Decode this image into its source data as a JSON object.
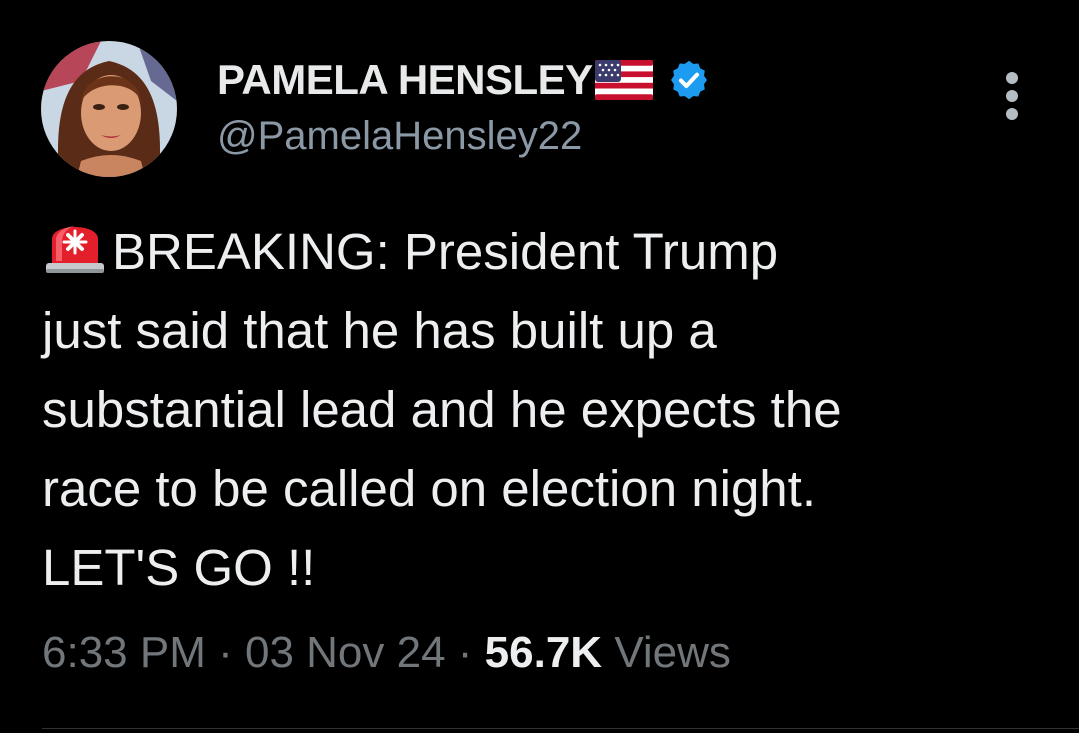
{
  "author": {
    "display_name": "PAMELA HENSLEY",
    "handle": "@PamelaHensley22",
    "flag_icon": "us-flag-icon",
    "verified_icon": "verified-badge-icon",
    "verified_color": "#1d9bf0"
  },
  "tweet": {
    "lines": [
      "BREAKING:  President Trump",
      "just said that he has built up a",
      "substantial lead and he expects the",
      "race to be called on election night.",
      "LET'S GO !!"
    ],
    "leading_icon": "siren-icon"
  },
  "meta": {
    "time": "6:33 PM",
    "separator": " · ",
    "date": "03 Nov 24",
    "views_count": "56.7K",
    "views_label": " Views"
  },
  "colors": {
    "background": "#000000",
    "primary_text": "#e7e9ea",
    "secondary_text": "#71767b",
    "accent": "#1d9bf0"
  }
}
